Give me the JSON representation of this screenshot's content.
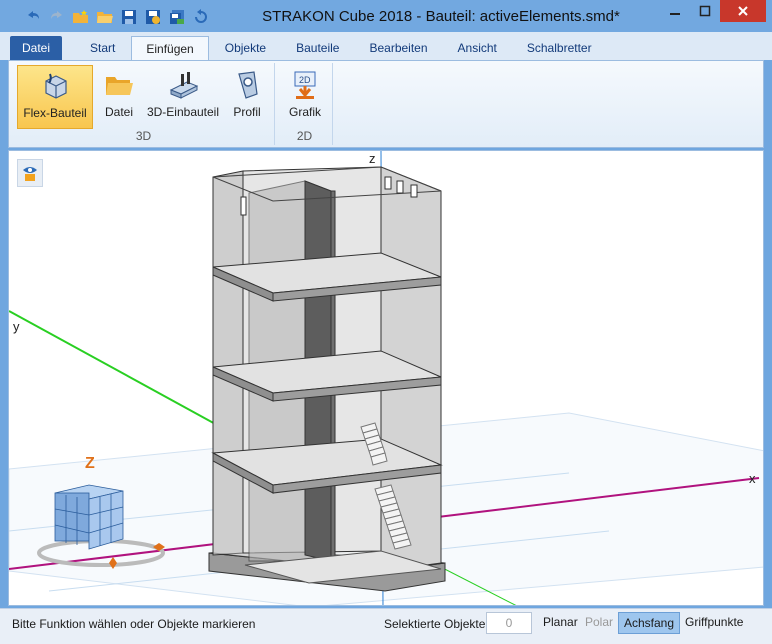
{
  "window": {
    "title": "STRAKON Cube 2018 - Bauteil: activeElements.smd*"
  },
  "ribbon": {
    "tabs": [
      {
        "label": "Datei"
      },
      {
        "label": "Start"
      },
      {
        "label": "Einfügen"
      },
      {
        "label": "Objekte"
      },
      {
        "label": "Bauteile"
      },
      {
        "label": "Bearbeiten"
      },
      {
        "label": "Ansicht"
      },
      {
        "label": "Schalbretter"
      }
    ],
    "groups": {
      "g3d": {
        "name": "3D",
        "buttons": [
          {
            "label": "Flex-Bauteil",
            "icon": "flex-component-icon"
          },
          {
            "label": "Datei",
            "icon": "folder-icon"
          },
          {
            "label": "3D-Einbauteil",
            "icon": "3d-insert-icon"
          },
          {
            "label": "Profil",
            "icon": "profile-icon"
          }
        ]
      },
      "g2d": {
        "name": "2D",
        "buttons": [
          {
            "label": "Grafik",
            "icon": "graphic-2d-icon"
          }
        ]
      }
    }
  },
  "viewport": {
    "axis_labels": {
      "z": "z",
      "y": "y",
      "x": "x"
    },
    "gizmo_axis": "Z"
  },
  "statusbar": {
    "message": "Bitte Funktion wählen oder Objekte markieren",
    "selected_label": "Selektierte Objekte",
    "selected_count": "0",
    "modes": {
      "planar": "Planar",
      "polar": "Polar",
      "achsfang": "Achsfang",
      "griffpunkte": "Griffpunkte"
    }
  },
  "colors": {
    "title_bar": "#72a8e0",
    "file_tab": "#2b5fa6",
    "selected_button": "#f8c64f",
    "x_axis": "#b0127e",
    "y_axis": "#29cf22",
    "z_axis": "#2a7fd4"
  }
}
